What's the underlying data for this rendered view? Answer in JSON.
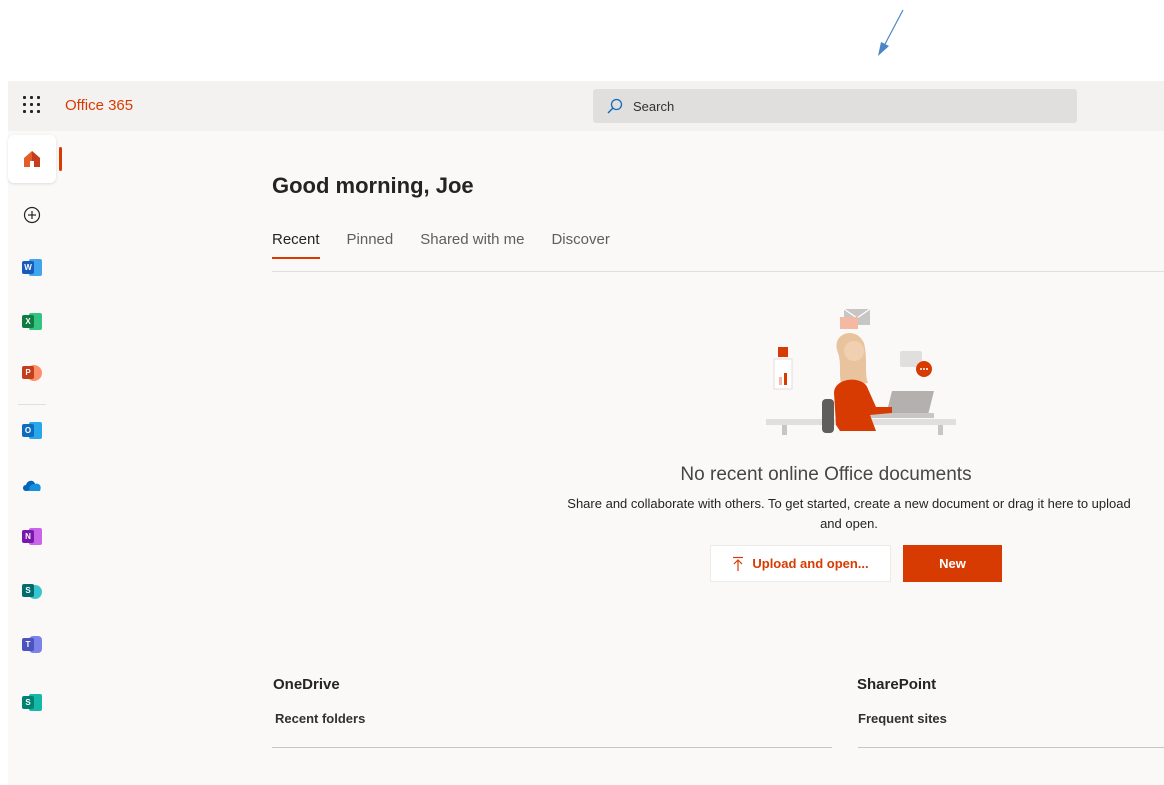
{
  "app": {
    "name": "Office 365"
  },
  "search": {
    "placeholder": "Search"
  },
  "greeting": "Good morning, Joe",
  "tabs": [
    {
      "label": "Recent",
      "active": true
    },
    {
      "label": "Pinned",
      "active": false
    },
    {
      "label": "Shared with me",
      "active": false
    },
    {
      "label": "Discover",
      "active": false
    }
  ],
  "rail": {
    "items": [
      {
        "name": "home",
        "icon": "home-icon"
      },
      {
        "name": "create",
        "icon": "plus-circle-icon"
      },
      {
        "name": "word",
        "icon": "word-icon",
        "letter": "W",
        "color": "#185abd"
      },
      {
        "name": "excel",
        "icon": "excel-icon",
        "letter": "X",
        "color": "#107c41"
      },
      {
        "name": "powerpoint",
        "icon": "powerpoint-icon",
        "letter": "P",
        "color": "#c43e1c"
      },
      {
        "name": "outlook",
        "icon": "outlook-icon",
        "letter": "O",
        "color": "#0f6cbd"
      },
      {
        "name": "onedrive",
        "icon": "onedrive-icon",
        "color": "#0364b8"
      },
      {
        "name": "onenote",
        "icon": "onenote-icon",
        "letter": "N",
        "color": "#7719aa"
      },
      {
        "name": "sharepoint",
        "icon": "sharepoint-icon",
        "letter": "S",
        "color": "#036c70"
      },
      {
        "name": "teams",
        "icon": "teams-icon",
        "letter": "T",
        "color": "#4b53bc"
      },
      {
        "name": "sway",
        "icon": "sway-icon",
        "letter": "S",
        "color": "#008272"
      }
    ]
  },
  "empty_state": {
    "title": "No recent online Office documents",
    "description": "Share and collaborate with others. To get started, create a new document or drag it here to upload and open.",
    "upload_label": "Upload and open...",
    "new_label": "New"
  },
  "sections": {
    "onedrive": {
      "title": "OneDrive",
      "subtitle": "Recent folders"
    },
    "sharepoint": {
      "title": "SharePoint",
      "subtitle": "Frequent sites"
    }
  },
  "colors": {
    "accent": "#d83b01",
    "header_bg": "#f3f2f1",
    "body_bg": "#faf9f8"
  }
}
